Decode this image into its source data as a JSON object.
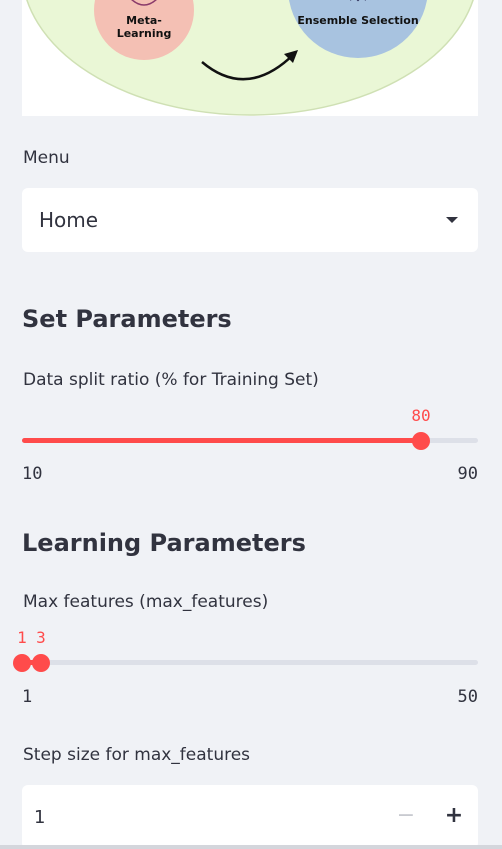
{
  "diagram": {
    "left_circle_label": "Meta-Learning",
    "right_circle_label": "Ensemble Selection",
    "colors": {
      "big_circle": "#eaf7d6",
      "left_circle": "#f4c0b4",
      "right_circle": "#a8c3e0"
    }
  },
  "menu": {
    "label": "Menu",
    "selected": "Home"
  },
  "set_parameters": {
    "heading": "Set Parameters",
    "split": {
      "label": "Data split ratio (% for Training Set)",
      "value": "80",
      "min": "10",
      "max": "90"
    }
  },
  "learning_parameters": {
    "heading": "Learning Parameters",
    "max_features": {
      "label": "Max features (max_features)",
      "low": "1",
      "high": "3",
      "min": "1",
      "max": "50"
    },
    "step": {
      "label": "Step size for max_features",
      "value": "1",
      "minus": "−",
      "plus": "+"
    }
  },
  "accent_color": "#ff4b4b"
}
